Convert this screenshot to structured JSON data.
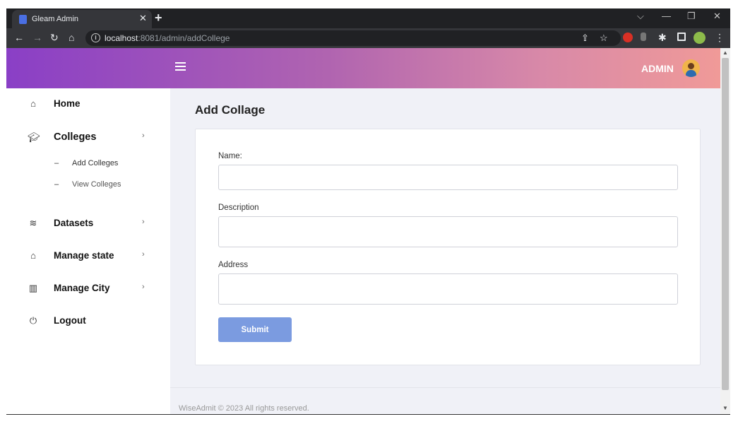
{
  "browser": {
    "tab_title": "Gleam Admin",
    "tab_close": "✕",
    "new_tab": "+",
    "url_host": "localhost",
    "url_rest": ":8081/admin/addCollege",
    "minimize": "—",
    "restore": "❐",
    "close": "✕",
    "dropdown": "⌵"
  },
  "header": {
    "admin_label": "ADMIN"
  },
  "sidebar": {
    "items": [
      {
        "label": "Home",
        "icon": "home-outline-icon"
      },
      {
        "label": "Colleges",
        "icon": "graduation-cap-icon",
        "expanded": true
      },
      {
        "label": "Datasets",
        "icon": "database-icon"
      },
      {
        "label": "Manage state",
        "icon": "house-icon"
      },
      {
        "label": "Manage City",
        "icon": "buildings-icon"
      },
      {
        "label": "Logout",
        "icon": "power-icon"
      }
    ],
    "sub_items": [
      {
        "label": "Add Colleges",
        "dash": "–"
      },
      {
        "label": "View Colleges",
        "dash": "–"
      }
    ],
    "chevron": "›"
  },
  "main": {
    "page_title": "Add Collage",
    "form": {
      "name_label": "Name:",
      "name_value": "",
      "description_label": "Description",
      "description_value": "",
      "address_label": "Address",
      "address_value": "",
      "submit_label": "Submit"
    },
    "footer": "WiseAdmit © 2023 All rights reserved."
  },
  "colors": {
    "header_gradient_start": "#8a3fc6",
    "header_gradient_end": "#f09a98",
    "submit_button": "#7b9be0",
    "main_background": "#f0f1f7"
  }
}
